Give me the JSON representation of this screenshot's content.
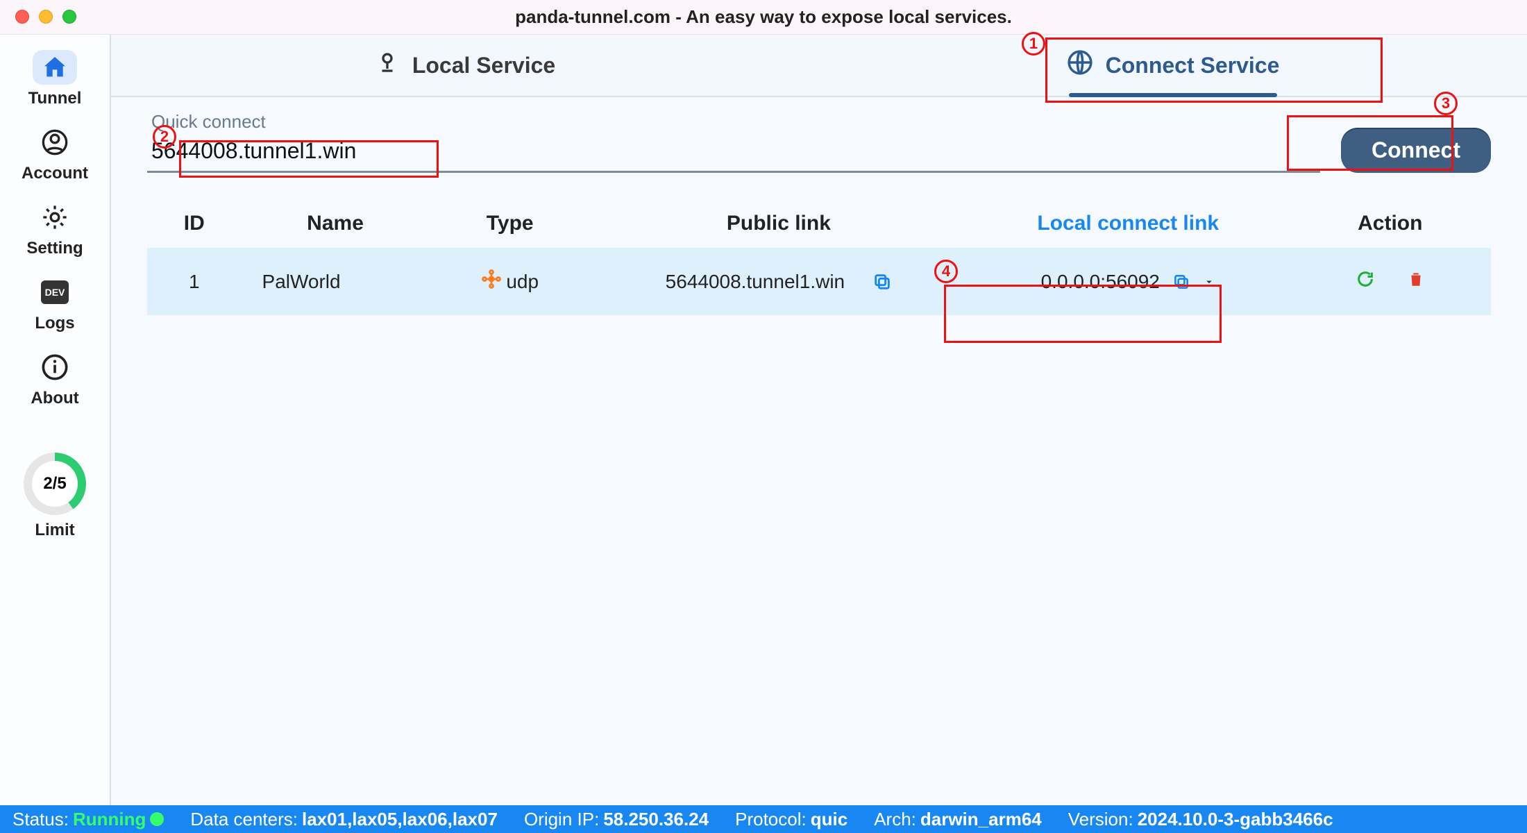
{
  "window_title": "panda-tunnel.com - An easy way to expose local services.",
  "sidebar": {
    "items": [
      {
        "label": "Tunnel"
      },
      {
        "label": "Account"
      },
      {
        "label": "Setting"
      },
      {
        "label": "Logs"
      },
      {
        "label": "About"
      }
    ],
    "limit": {
      "text": "2/5",
      "label": "Limit"
    }
  },
  "tabs": {
    "local": "Local Service",
    "connect": "Connect Service"
  },
  "quick": {
    "label": "Quick connect",
    "value": "5644008.tunnel1.win",
    "button": "Connect"
  },
  "table": {
    "headers": {
      "id": "ID",
      "name": "Name",
      "type": "Type",
      "public": "Public link",
      "local": "Local connect link",
      "action": "Action"
    },
    "rows": [
      {
        "id": "1",
        "name": "PalWorld",
        "type": "udp",
        "public": "5644008.tunnel1.win",
        "local": "0.0.0.0:56092"
      }
    ]
  },
  "status": {
    "status_label": "Status:",
    "status_value": "Running",
    "dc_label": "Data centers:",
    "dc_value": "lax01,lax05,lax06,lax07",
    "origin_label": "Origin IP:",
    "origin_value": "58.250.36.24",
    "proto_label": "Protocol:",
    "proto_value": "quic",
    "arch_label": "Arch:",
    "arch_value": "darwin_arm64",
    "version_label": "Version:",
    "version_value": "2024.10.0-3-gabb3466c"
  },
  "annotations": {
    "a1": "1",
    "a2": "2",
    "a3": "3",
    "a4": "4"
  }
}
